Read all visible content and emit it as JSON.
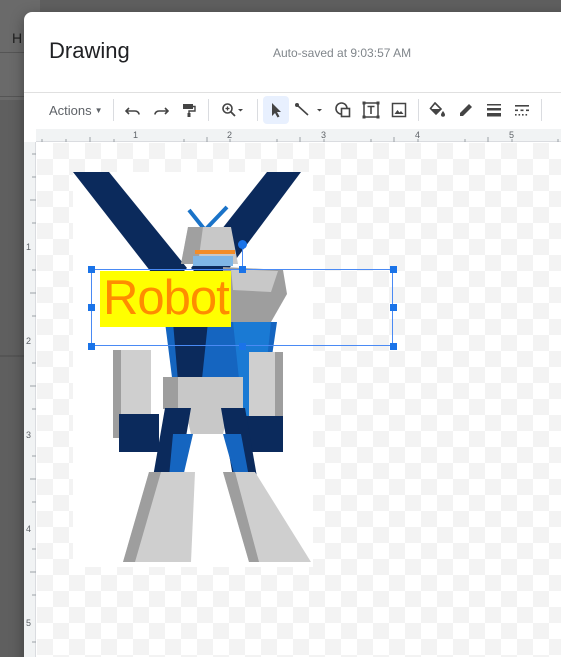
{
  "background_doc": {
    "letter": "H"
  },
  "dialog": {
    "title": "Drawing",
    "autosave_status": "Auto-saved at 9:03:57 AM"
  },
  "toolbar": {
    "actions_label": "Actions",
    "buttons": [
      "undo-icon",
      "redo-icon",
      "paint-format-icon",
      "zoom-icon",
      "select-icon",
      "line-icon",
      "shape-icon",
      "text-box-icon",
      "image-icon",
      "fill-color-icon",
      "border-color-icon",
      "border-weight-icon",
      "border-dash-icon"
    ],
    "selected_tool": "select-icon"
  },
  "rulers": {
    "top_labels": [
      "1",
      "2",
      "3",
      "4",
      "5"
    ],
    "left_labels": [
      "1",
      "2",
      "3",
      "4",
      "5"
    ]
  },
  "canvas": {
    "text_box": {
      "text": "Robot",
      "fill_color": "#ffff00",
      "text_color": "#ff8c00"
    },
    "selection_color": "#1a73e8"
  }
}
